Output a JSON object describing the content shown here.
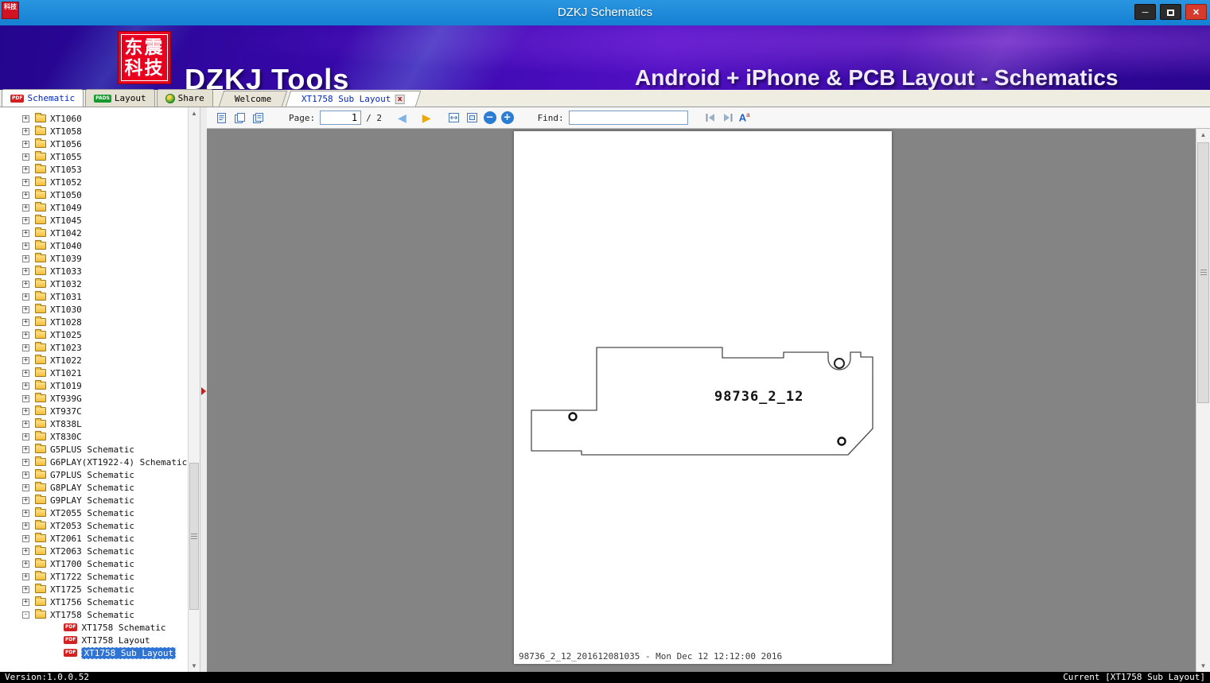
{
  "window": {
    "title": "DZKJ Schematics",
    "minimize_glyph": "─",
    "close_glyph": "✕"
  },
  "banner": {
    "logo_line1": "东震",
    "logo_line2": "科技",
    "app_name": "DZKJ Tools",
    "subtitle": "Android + iPhone & PCB Layout - Schematics"
  },
  "colors": {
    "titlebar_blue": "#1580d2",
    "banner_purple": "#3c08b0",
    "logo_red": "#e8001e",
    "selection_blue": "#2f74d4",
    "pdf_red": "#d42020",
    "pads_green": "#15992e",
    "forward_gold": "#f0a800"
  },
  "icons": {
    "pdf_badge": "PDF",
    "pads_badge": "PADS",
    "tab_close": "x",
    "back": "◀",
    "forward": "▶",
    "zoom_out": "−",
    "zoom_in": "+",
    "scroll_up": "▲",
    "scroll_down": "▼",
    "font_big": "A",
    "font_small": "a"
  },
  "main_tabs": [
    {
      "label": "Schematic",
      "active": true
    },
    {
      "label": "Layout",
      "active": false
    },
    {
      "label": "Share",
      "active": false
    }
  ],
  "doc_tabs": [
    {
      "label": "Welcome",
      "active": false
    },
    {
      "label": "XT1758 Sub Layout",
      "active": true,
      "closable": true
    }
  ],
  "toolbar": {
    "page_label": "Page:",
    "page_value": "1",
    "page_total": "/ 2",
    "find_label": "Find:",
    "find_value": ""
  },
  "tree": {
    "items": [
      {
        "label": "XT1060",
        "toggle": "+",
        "icon": "folder",
        "level": 0
      },
      {
        "label": "XT1058",
        "toggle": "+",
        "icon": "folder",
        "level": 0
      },
      {
        "label": "XT1056",
        "toggle": "+",
        "icon": "folder",
        "level": 0
      },
      {
        "label": "XT1055",
        "toggle": "+",
        "icon": "folder",
        "level": 0
      },
      {
        "label": "XT1053",
        "toggle": "+",
        "icon": "folder",
        "level": 0
      },
      {
        "label": "XT1052",
        "toggle": "+",
        "icon": "folder",
        "level": 0
      },
      {
        "label": "XT1050",
        "toggle": "+",
        "icon": "folder",
        "level": 0
      },
      {
        "label": "XT1049",
        "toggle": "+",
        "icon": "folder",
        "level": 0
      },
      {
        "label": "XT1045",
        "toggle": "+",
        "icon": "folder",
        "level": 0
      },
      {
        "label": "XT1042",
        "toggle": "+",
        "icon": "folder",
        "level": 0
      },
      {
        "label": "XT1040",
        "toggle": "+",
        "icon": "folder",
        "level": 0
      },
      {
        "label": "XT1039",
        "toggle": "+",
        "icon": "folder",
        "level": 0
      },
      {
        "label": "XT1033",
        "toggle": "+",
        "icon": "folder",
        "level": 0
      },
      {
        "label": "XT1032",
        "toggle": "+",
        "icon": "folder",
        "level": 0
      },
      {
        "label": "XT1031",
        "toggle": "+",
        "icon": "folder",
        "level": 0
      },
      {
        "label": "XT1030",
        "toggle": "+",
        "icon": "folder",
        "level": 0
      },
      {
        "label": "XT1028",
        "toggle": "+",
        "icon": "folder",
        "level": 0
      },
      {
        "label": "XT1025",
        "toggle": "+",
        "icon": "folder",
        "level": 0
      },
      {
        "label": "XT1023",
        "toggle": "+",
        "icon": "folder",
        "level": 0
      },
      {
        "label": "XT1022",
        "toggle": "+",
        "icon": "folder",
        "level": 0
      },
      {
        "label": "XT1021",
        "toggle": "+",
        "icon": "folder",
        "level": 0
      },
      {
        "label": "XT1019",
        "toggle": "+",
        "icon": "folder",
        "level": 0
      },
      {
        "label": "XT939G",
        "toggle": "+",
        "icon": "folder",
        "level": 0
      },
      {
        "label": "XT937C",
        "toggle": "+",
        "icon": "folder",
        "level": 0
      },
      {
        "label": "XT838L",
        "toggle": "+",
        "icon": "folder",
        "level": 0
      },
      {
        "label": "XT830C",
        "toggle": "+",
        "icon": "folder",
        "level": 0
      },
      {
        "label": "G5PLUS Schematic",
        "toggle": "+",
        "icon": "folder",
        "level": 0
      },
      {
        "label": "G6PLAY(XT1922-4) Schematic",
        "toggle": "+",
        "icon": "folder",
        "level": 0
      },
      {
        "label": "G7PLUS Schematic",
        "toggle": "+",
        "icon": "folder",
        "level": 0
      },
      {
        "label": "G8PLAY Schematic",
        "toggle": "+",
        "icon": "folder",
        "level": 0
      },
      {
        "label": "G9PLAY Schematic",
        "toggle": "+",
        "icon": "folder",
        "level": 0
      },
      {
        "label": "XT2055 Schematic",
        "toggle": "+",
        "icon": "folder",
        "level": 0
      },
      {
        "label": "XT2053 Schematic",
        "toggle": "+",
        "icon": "folder",
        "level": 0
      },
      {
        "label": "XT2061 Schematic",
        "toggle": "+",
        "icon": "folder",
        "level": 0
      },
      {
        "label": "XT2063 Schematic",
        "toggle": "+",
        "icon": "folder",
        "level": 0
      },
      {
        "label": "XT1700 Schematic",
        "toggle": "+",
        "icon": "folder",
        "level": 0
      },
      {
        "label": "XT1722 Schematic",
        "toggle": "+",
        "icon": "folder",
        "level": 0
      },
      {
        "label": "XT1725 Schematic",
        "toggle": "+",
        "icon": "folder",
        "level": 0
      },
      {
        "label": "XT1756 Schematic",
        "toggle": "+",
        "icon": "folder",
        "level": 0
      },
      {
        "label": "XT1758 Schematic",
        "toggle": "-",
        "icon": "folder",
        "level": 0
      },
      {
        "label": "XT1758 Schematic",
        "icon": "pdf",
        "level": 1
      },
      {
        "label": "XT1758 Layout",
        "icon": "pdf",
        "level": 1
      },
      {
        "label": "XT1758 Sub Layout",
        "icon": "pdf",
        "level": 1,
        "selected": true
      }
    ]
  },
  "document": {
    "part_label": "98736_2_12",
    "footer": "98736_2_12_201612081035 - Mon Dec 12 12:12:00 2016"
  },
  "statusbar": {
    "version": "Version:1.0.0.52",
    "current": "Current [XT1758 Sub Layout]"
  }
}
